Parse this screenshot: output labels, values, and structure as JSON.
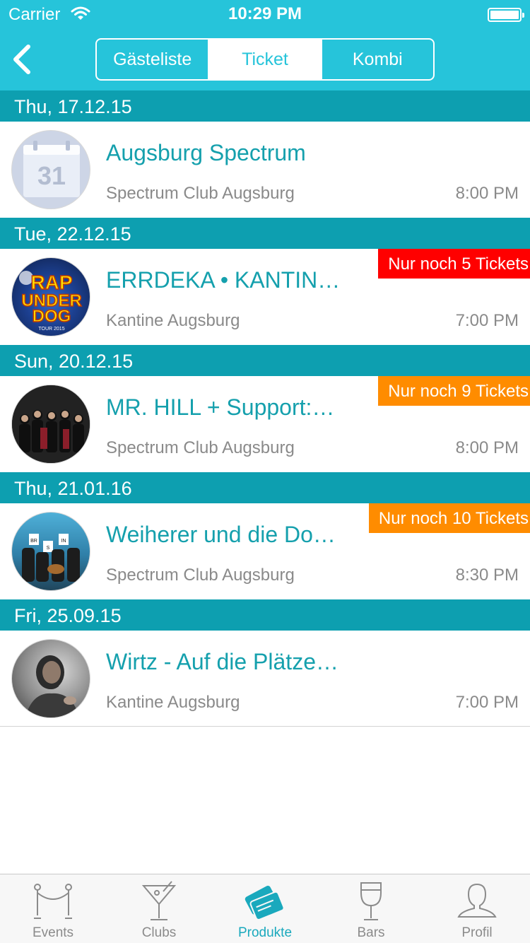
{
  "status_bar": {
    "carrier": "Carrier",
    "time": "10:29 PM"
  },
  "segments": [
    {
      "label": "Gästeliste"
    },
    {
      "label": "Ticket"
    },
    {
      "label": "Kombi"
    }
  ],
  "sections": [
    {
      "date": "Thu, 17.12.15",
      "event": {
        "title": "Augsburg Spectrum",
        "venue": "Spectrum Club Augsburg",
        "time": "8:00 PM",
        "badge": "",
        "image": "calendar-icon"
      }
    },
    {
      "date": "Tue, 22.12.15",
      "event": {
        "title": "ERRDEKA • KANTIN…",
        "venue": "Kantine Augsburg",
        "time": "7:00 PM",
        "badge": "Nur noch 5 Tickets",
        "badge_color": "#ff0000",
        "image": "rap-underdog-poster",
        "image_text_1": "RAP",
        "image_text_2": "UNDER",
        "image_text_3": "DOG",
        "image_text_4": "TOUR 2015"
      }
    },
    {
      "date": "Sun, 20.12.15",
      "event": {
        "title": "MR. HILL + Support:…",
        "venue": "Spectrum Club Augsburg",
        "time": "8:00 PM",
        "badge": "Nur noch 9 Tickets",
        "badge_color": "#ff8c00",
        "image": "band-photo"
      }
    },
    {
      "date": "Thu, 21.01.16",
      "event": {
        "title": "Weiherer und die Do…",
        "venue": "Spectrum Club Augsburg",
        "time": "8:30 PM",
        "badge": "Nur noch 10 Tickets",
        "badge_color": "#ff8c00",
        "image": "band-photo",
        "image_text_1": "BR",
        "image_text_2": "S",
        "image_text_3": "IN"
      }
    },
    {
      "date": "Fri, 25.09.15",
      "event": {
        "title": "Wirtz - Auf die Plätze…",
        "venue": "Kantine Augsburg",
        "time": "7:00 PM",
        "badge": "",
        "image": "artist-photo"
      }
    }
  ],
  "tabs": [
    {
      "label": "Events",
      "icon": "rope-barrier-icon"
    },
    {
      "label": "Clubs",
      "icon": "cocktail-icon"
    },
    {
      "label": "Produkte",
      "icon": "tickets-icon",
      "active": true
    },
    {
      "label": "Bars",
      "icon": "wine-glass-icon"
    },
    {
      "label": "Profil",
      "icon": "person-icon"
    }
  ],
  "colors": {
    "accent": "#26c4da",
    "section_header": "#0d9fb0",
    "title_text": "#15a0ad",
    "badge_red": "#ff0000",
    "badge_orange": "#ff8c00"
  }
}
